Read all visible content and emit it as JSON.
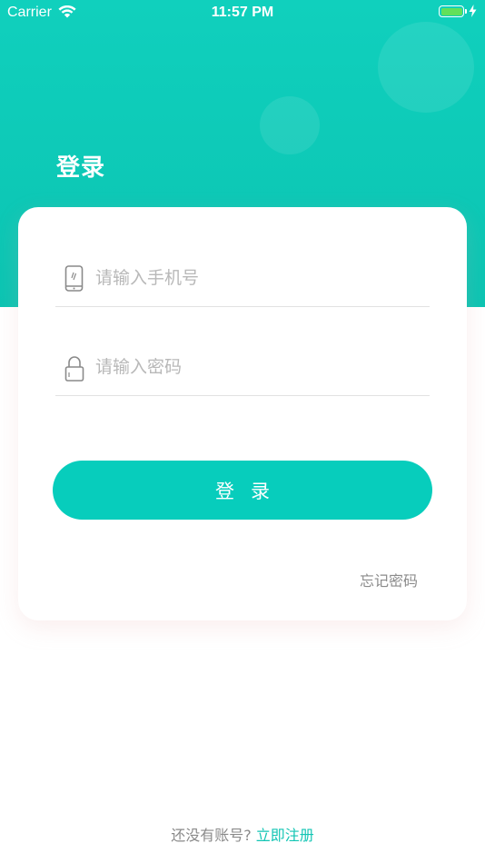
{
  "status_bar": {
    "carrier": "Carrier",
    "time": "11:57 PM"
  },
  "page": {
    "title": "登录"
  },
  "form": {
    "phone_placeholder": "请输入手机号",
    "password_placeholder": "请输入密码",
    "login_label": "登录",
    "forgot_label": "忘记密码"
  },
  "footer": {
    "prompt": "还没有账号?",
    "register_label": "立即注册"
  },
  "colors": {
    "accent": "#07cdbc",
    "battery": "#62e05a"
  },
  "icons": [
    "wifi-icon",
    "battery-icon",
    "charging-icon",
    "phone-icon",
    "lock-icon"
  ]
}
